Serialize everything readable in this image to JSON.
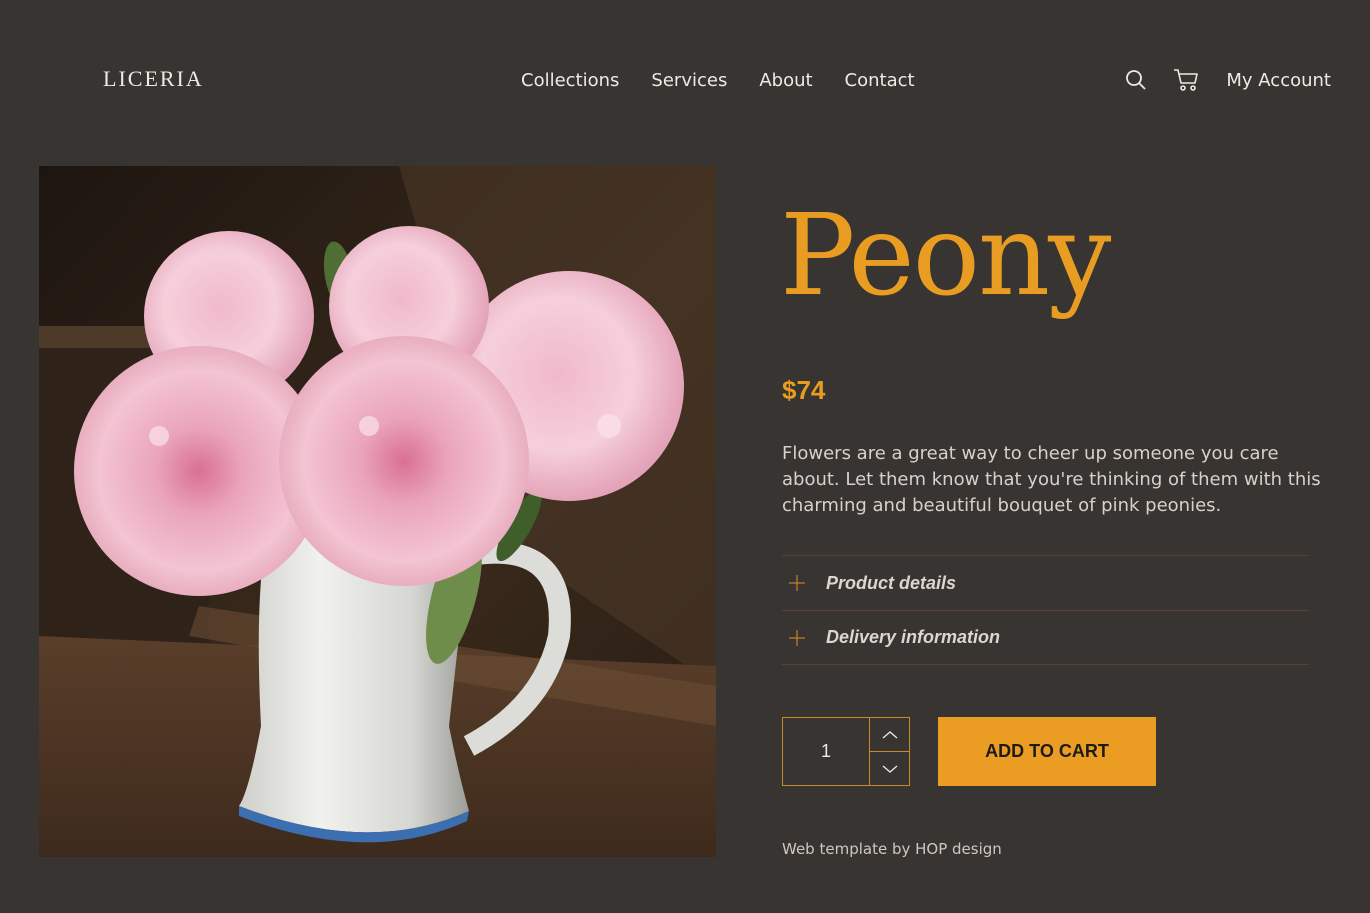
{
  "brand": {
    "logo": "LICERIA"
  },
  "nav": {
    "items": [
      "Collections",
      "Services",
      "About",
      "Contact"
    ]
  },
  "header": {
    "search_icon": "search-icon",
    "cart_icon": "cart-icon",
    "account_label": "My Account"
  },
  "product": {
    "image": "pink-peonies-in-white-pitcher",
    "title": "Peony",
    "price": "$74",
    "description": "Flowers are a great way to cheer up someone you care about. Let them know that you're thinking of them with this charming and beautiful bouquet of pink peonies.",
    "accordion": [
      {
        "label": "Product details"
      },
      {
        "label": "Delivery information"
      }
    ],
    "quantity": "1",
    "add_to_cart": "ADD TO CART"
  },
  "footer": {
    "credit": "Web template by HOP design"
  },
  "colors": {
    "background": "#383432",
    "accent": "#e89d22",
    "divider": "#5a403a"
  }
}
